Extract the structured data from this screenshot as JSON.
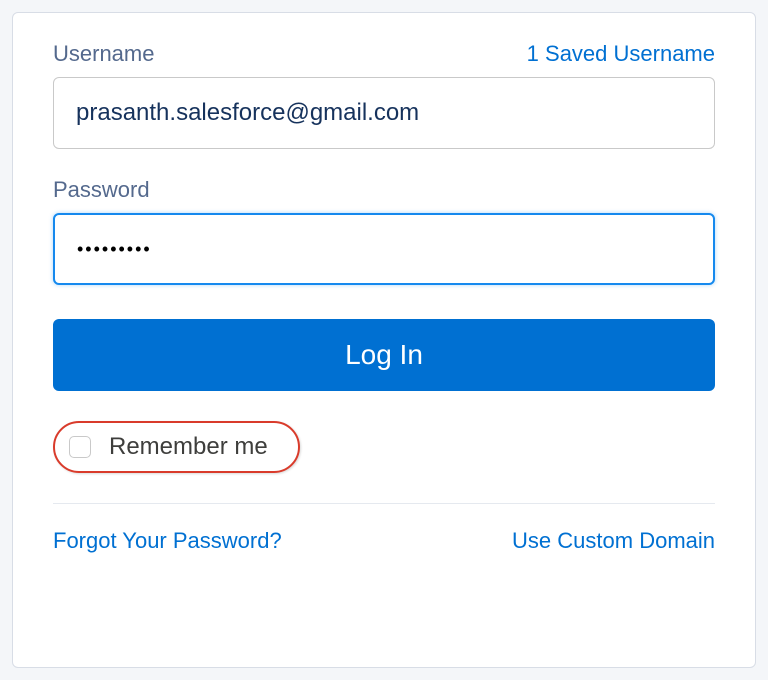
{
  "labels": {
    "username": "Username",
    "password": "Password",
    "remember": "Remember me"
  },
  "links": {
    "saved_usernames": "1 Saved Username",
    "forgot_password": "Forgot Your Password?",
    "custom_domain": "Use Custom Domain"
  },
  "inputs": {
    "username_value": "prasanth.salesforce@gmail.com",
    "password_value": "•••••••••"
  },
  "buttons": {
    "login": "Log In"
  }
}
